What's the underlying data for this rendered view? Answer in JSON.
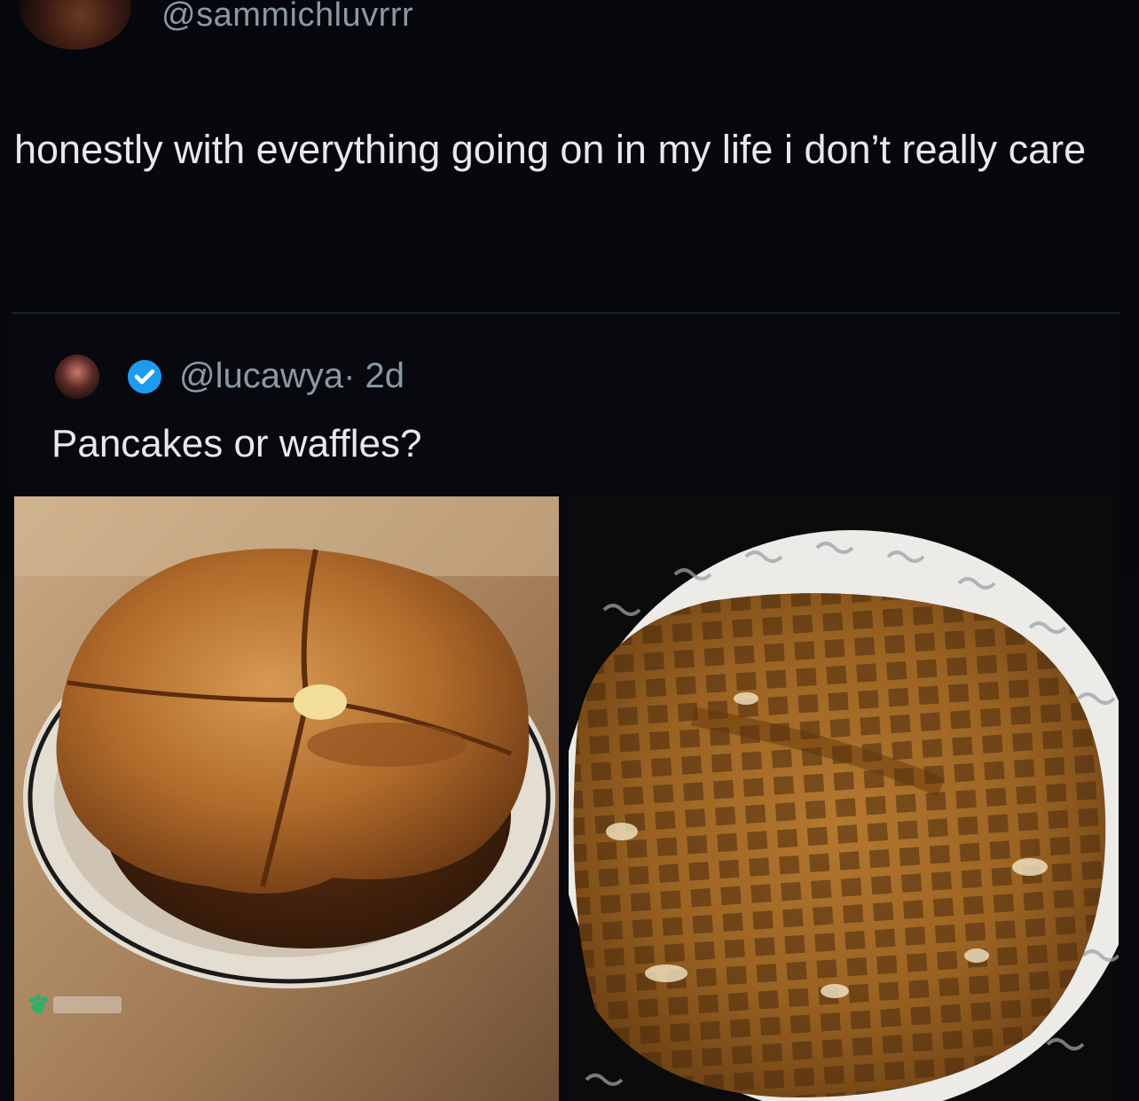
{
  "post": {
    "handle": "@sammichluvrrr",
    "text": "honestly with everything going on in my life i don’t really care"
  },
  "quote": {
    "handle": "@lucawya",
    "meta": "· 2d",
    "text": "Pancakes or waffles?",
    "verified": true
  },
  "images": [
    {
      "name": "pancakes-photo",
      "icon": "pancakes-plate"
    },
    {
      "name": "waffle-photo",
      "icon": "waffle-plate"
    }
  ],
  "colors": {
    "background": "#06080d",
    "text": "#e7e9ea",
    "muted": "#8b98a5",
    "verified": "#1d9bf0"
  }
}
